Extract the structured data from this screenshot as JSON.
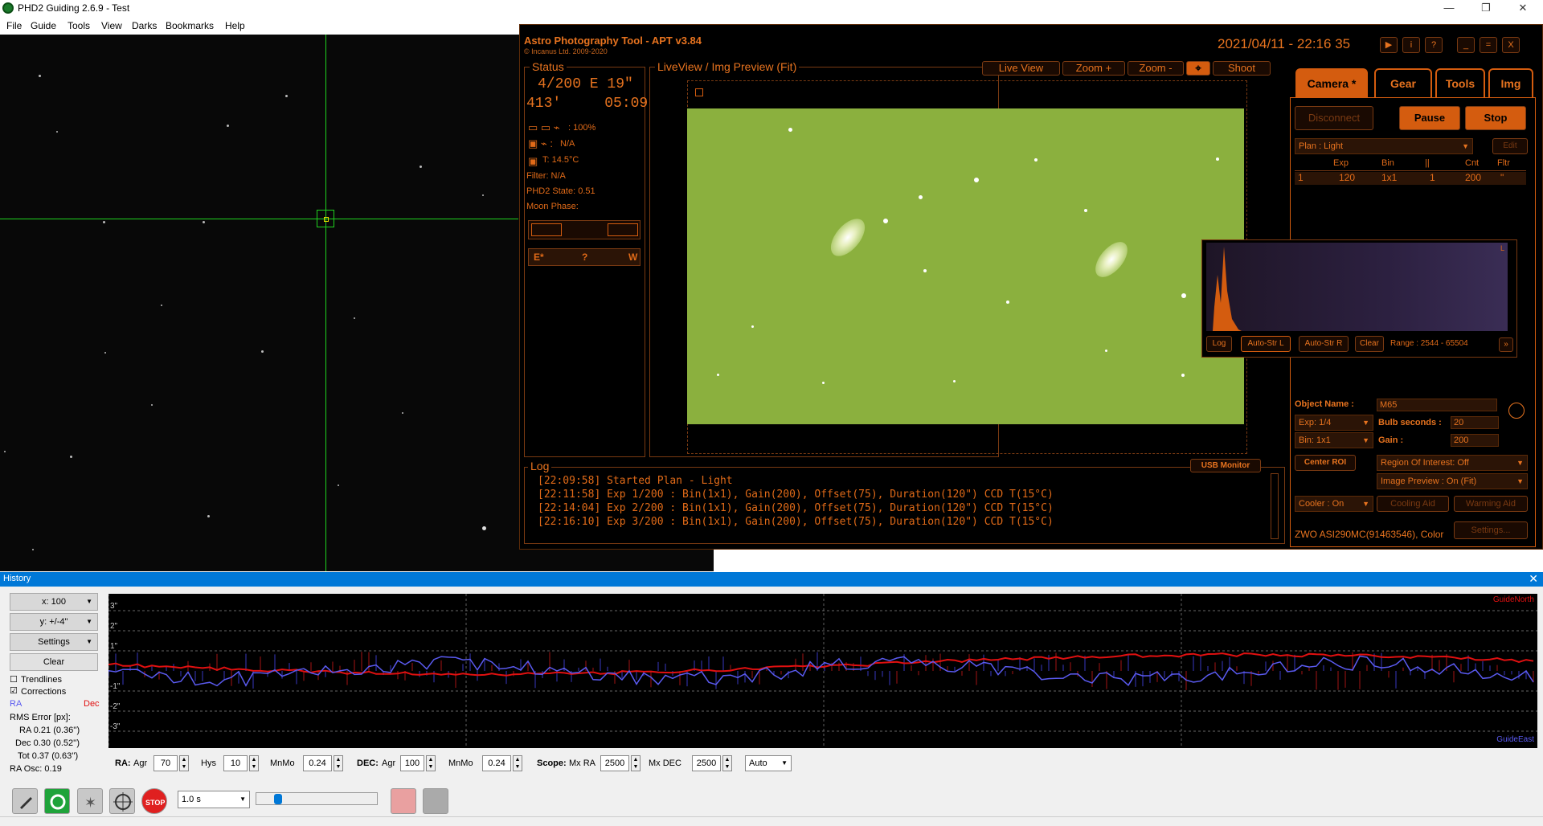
{
  "phd2": {
    "title": "PHD2 Guiding 2.6.9 - Test",
    "menu": [
      "File",
      "Guide",
      "Tools",
      "View",
      "Darks",
      "Bookmarks",
      "Help"
    ],
    "window_controls": [
      "—",
      "❐",
      "✕"
    ]
  },
  "apt": {
    "title": "Astro Photography Tool  -  APT v3.84",
    "subtitle": "© Incanus Ltd. 2009-2020",
    "clock": "2021/04/11 - 22:16 35",
    "header_buttons": [
      "▶",
      "i",
      "?",
      "_",
      "=",
      "X"
    ],
    "status": {
      "label": "Status",
      "line1": "4/200 E 19\"",
      "line2": "413'     05:09",
      "battery": ": 100%",
      "power": "N/A",
      "temp": "T:  14.5°C",
      "filter": "Filter: N/A",
      "phd2_state": "PHD2 State: 0.51",
      "moon": "Moon Phase:",
      "dir_e": "E*",
      "dir_q": "?",
      "dir_w": "W"
    },
    "preview": {
      "label": "LiveView / Img Preview (Fit)",
      "buttons": [
        "Live View",
        "Zoom +",
        "Zoom -",
        "⌖",
        "Shoot"
      ]
    },
    "tabs": [
      "Camera *",
      "Gear",
      "Tools",
      "Img"
    ],
    "camera": {
      "disconnect": "Disconnect",
      "pause": "Pause",
      "stop": "Stop",
      "plan": "Plan : Light",
      "edit": "Edit",
      "plan_headers": [
        "Exp",
        "Bin",
        "||",
        "Cnt",
        "Fltr"
      ],
      "plan_row": {
        "idx": "1",
        "exp": "120",
        "bin": "1x1",
        "n": "1",
        "cnt": "200",
        "fltr": "\""
      },
      "object_name_label": "Object Name :",
      "object_name": "M65",
      "exp": "Exp: 1/4",
      "bulb_label": "Bulb seconds :",
      "bulb": "20",
      "bin": "Bin: 1x1",
      "gain_label": "Gain :",
      "gain": "200",
      "center_roi": "Center ROI",
      "roi": "Region Of Interest: Off",
      "img_preview": "Image Preview : On (Fit)",
      "cooler": "Cooler : On",
      "cooling_aid": "Cooling Aid",
      "warming_aid": "Warming Aid",
      "camera_name": "ZWO ASI290MC(91463546), Color",
      "settings": "Settings..."
    },
    "histogram": {
      "log": "Log",
      "auto_l": "Auto-Str L",
      "auto_r": "Auto-Str R",
      "clear": "Clear",
      "range": "Range : 2544 - 65504",
      "corner": "L"
    },
    "log": {
      "label": "Log",
      "usb": "USB Monitor",
      "lines": [
        "[22:09:58] Started Plan - Light",
        "[22:11:58] Exp 1/200 : Bin(1x1), Gain(200), Offset(75), Duration(120\") CCD T(15°C)",
        "[22:14:04] Exp 2/200 : Bin(1x1), Gain(200), Offset(75), Duration(120\") CCD T(15°C)",
        "[22:16:10] Exp 3/200 : Bin(1x1), Gain(200), Offset(75), Duration(120\") CCD T(15°C)"
      ]
    }
  },
  "history": {
    "title": "History",
    "close": "✕",
    "x_scale": "x: 100",
    "y_scale": "y: +/-4\"",
    "settings": "Settings",
    "clear": "Clear",
    "trendlines": "Trendlines",
    "corrections": "Corrections",
    "ra": "RA",
    "dec": "Dec",
    "rms_title": "RMS Error [px]:",
    "rms_ra": "RA  0.21 (0.36'')",
    "rms_dec": "Dec  0.30 (0.52'')",
    "rms_tot": "Tot  0.37 (0.63'')",
    "ra_osc": "RA Osc: 0.19",
    "y_labels": [
      "3\"",
      "2\"",
      "1\"",
      "-1\"",
      "-2\"",
      "-3\""
    ],
    "guide_north": "GuideNorth",
    "guide_east": "GuideEast",
    "controls": {
      "ra_label": "RA:",
      "agr": "Agr",
      "ra_agr": "70",
      "hys": "Hys",
      "hys_val": "10",
      "mnmo": "MnMo",
      "ra_mnmo": "0.24",
      "dec_label": "DEC:",
      "dec_agr": "100",
      "dec_mnmo": "0.24",
      "scope_label": "Scope:",
      "mx_ra": "Mx RA",
      "mx_ra_val": "2500",
      "mx_dec": "Mx DEC",
      "mx_dec_val": "2500",
      "mode": "Auto"
    },
    "ra_color": "#5a5af0",
    "dec_color": "#e01010"
  },
  "toolbar": {
    "exposure": "1.0 s"
  }
}
